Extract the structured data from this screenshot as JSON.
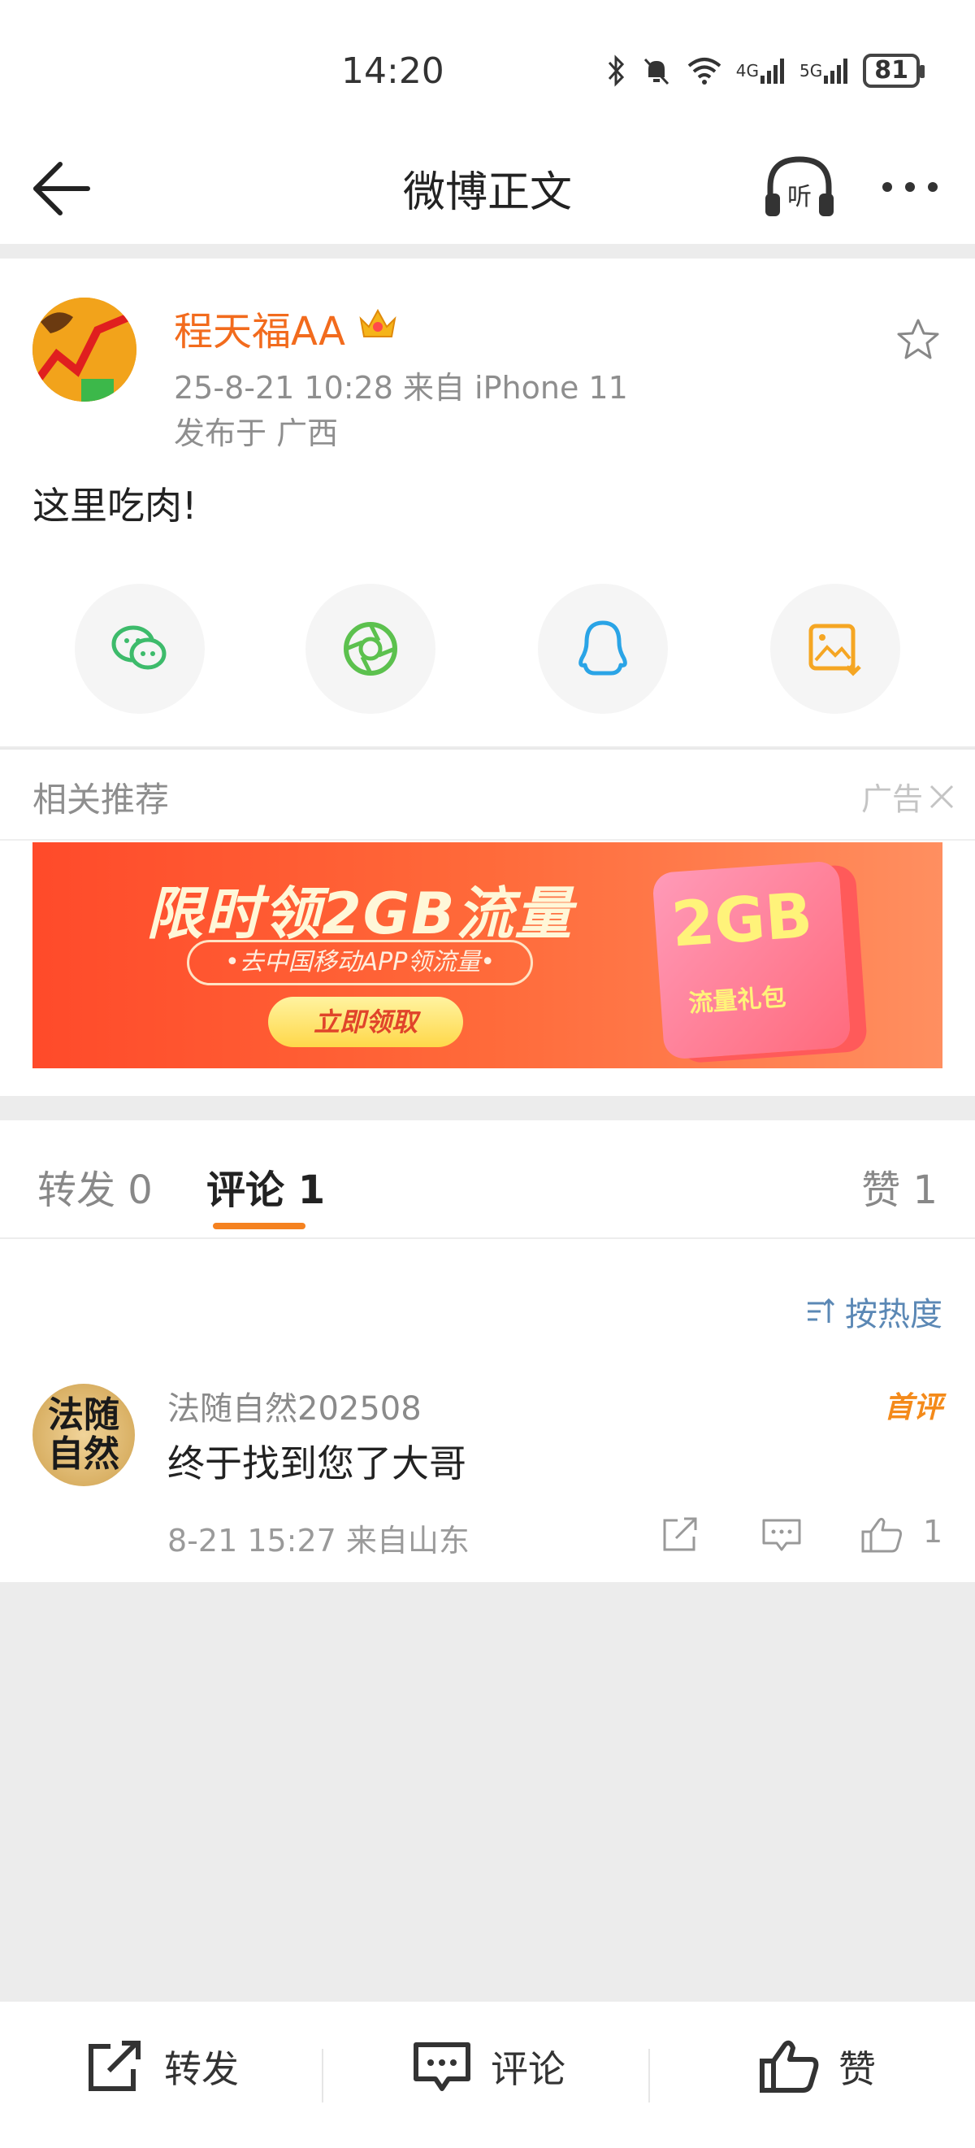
{
  "status_bar": {
    "time": "14:20",
    "battery": "81",
    "net1": "4G",
    "net2": "5G"
  },
  "header": {
    "title": "微博正文"
  },
  "post": {
    "username": "程天福AA",
    "meta_time_source": "25-8-21 10:28  来自 iPhone 11",
    "location": "发布于 广西",
    "text": "这里吃肉!"
  },
  "related": {
    "title": "相关推荐",
    "ad_label": "广告",
    "banner": {
      "headline": "限时领2GB流量",
      "subline": "•去中国移动APP领流量•",
      "button": "立即领取",
      "card_main": "2GB",
      "card_sub": "流量礼包"
    }
  },
  "tabs": {
    "repost": "转发 0",
    "comment": "评论 1",
    "like": "赞 1"
  },
  "comments": {
    "sort_label": "按热度",
    "items": [
      {
        "avatar_text": "法随\n自然",
        "name": "法随自然202508",
        "text": "终于找到您了大哥",
        "meta": "8-21 15:27  来自山东",
        "badge": "首评",
        "likes": "1"
      }
    ]
  },
  "bottom_bar": {
    "repost": "转发",
    "comment": "评论",
    "like": "赞"
  },
  "colors": {
    "accent_orange": "#f58220",
    "username": "#f26b1d",
    "link_blue": "#5b88b5"
  }
}
